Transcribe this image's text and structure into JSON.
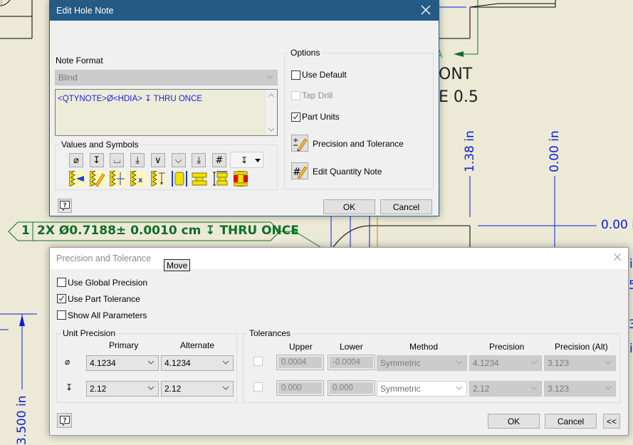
{
  "drawing": {
    "texts": [
      "ONT",
      "E 0.5"
    ],
    "dim_labels": [
      "1.38 in",
      "0.00 in",
      "0.00 i",
      "3.500 in"
    ],
    "right_edge_fragments": [
      "i",
      "5",
      "3",
      "i"
    ],
    "leader_note": {
      "balloon": "1",
      "text": "2X Ø0.7188± 0.0010 cm ↧ THRU ONCE"
    },
    "colors": {
      "background": "#ecead6",
      "dimension": "#0b1be0",
      "leader": "#106d2a",
      "geometry": "#000000"
    }
  },
  "edit_hole_note": {
    "title": "Edit Hole Note",
    "note_format_label": "Note Format",
    "note_format_value": "Blind",
    "note_text": "<QTYNOTE>Ø<HDIA> ↧ THRU ONCE",
    "values_symbols_label": "Values and Symbols",
    "symbol_buttons": [
      {
        "name": "diameter",
        "glyph": "⌀"
      },
      {
        "name": "depth",
        "glyph": "↧"
      },
      {
        "name": "counterbore",
        "glyph": "⌴"
      },
      {
        "name": "spotface",
        "glyph": "⤓"
      },
      {
        "name": "countersink",
        "glyph": "∨"
      },
      {
        "name": "countersink-point",
        "glyph": "⌵"
      },
      {
        "name": "depth-arrow",
        "glyph": "⤓"
      },
      {
        "name": "quantity",
        "glyph": "#"
      }
    ],
    "symbol_dropdown_glyph": "↧",
    "value_buttons": [
      "thread-designation",
      "edit-value",
      "thread-pitch",
      "thread-multiplier",
      "thread-depth",
      "thread-class",
      "fastener",
      "fastener-length",
      "fastener-red"
    ],
    "options_label": "Options",
    "options": [
      {
        "label": "Use Default",
        "checked": false,
        "enabled": true
      },
      {
        "label": "Tap Drill",
        "checked": false,
        "enabled": false
      },
      {
        "label": "Part Units",
        "checked": true,
        "enabled": true
      }
    ],
    "precision_button_label": "Precision and Tolerance",
    "quantity_button_label": "Edit Quantity Note",
    "ok_label": "OK",
    "cancel_label": "Cancel",
    "help_glyph": "?"
  },
  "precision_tolerance": {
    "title": "Precision and Tolerance",
    "tooltip": "Move",
    "checkboxes": [
      {
        "label": "Use Global Precision",
        "checked": false
      },
      {
        "label": "Use Part Tolerance",
        "checked": true
      },
      {
        "label": "Show All Parameters",
        "checked": false
      }
    ],
    "unit_precision": {
      "label": "Unit Precision",
      "headers": [
        "Primary",
        "Alternate"
      ],
      "rows": [
        {
          "symbol": "⌀",
          "primary": "4.1234",
          "alternate": "4.1234"
        },
        {
          "symbol": "↧",
          "primary": "2.12",
          "alternate": "2.12"
        }
      ]
    },
    "tolerances": {
      "label": "Tolerances",
      "headers": [
        "Upper",
        "Lower",
        "Method",
        "Precision",
        "Precision (Alt)"
      ],
      "rows": [
        {
          "enabled": false,
          "upper": "0.0004",
          "lower": "-0.0004",
          "method": "Symmetric",
          "precision": "4.1234",
          "precision_alt": "3.123"
        },
        {
          "enabled": false,
          "upper": "0.000",
          "lower": "0.000",
          "method": "Symmetric",
          "precision": "2.12",
          "precision_alt": "3.123"
        }
      ]
    },
    "ok_label": "OK",
    "cancel_label": "Cancel",
    "collapse_label": "<<",
    "help_glyph": "?"
  }
}
